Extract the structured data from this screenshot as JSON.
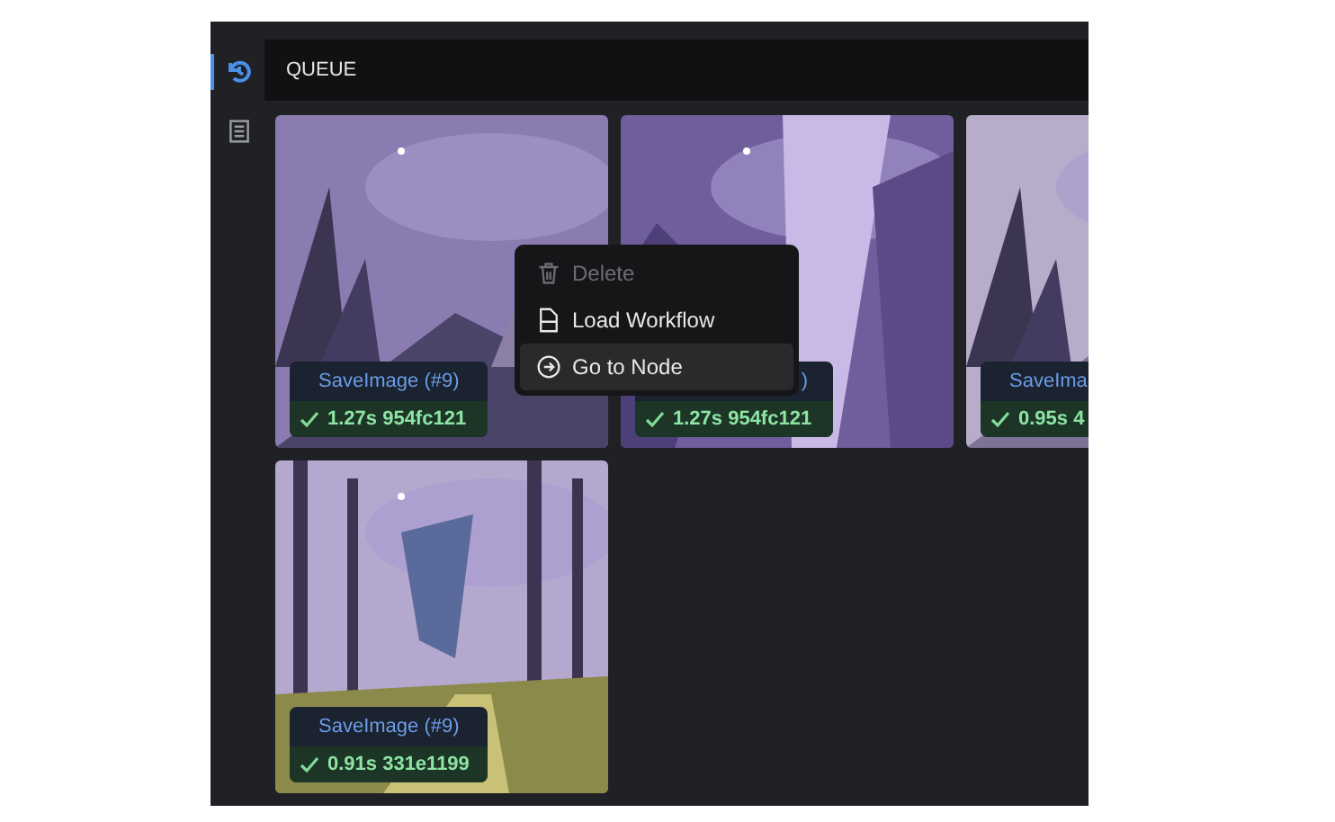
{
  "sidebar": {
    "items": [
      {
        "kind": "history",
        "selected": true
      },
      {
        "kind": "document",
        "selected": false
      }
    ]
  },
  "header": {
    "title": "QUEUE"
  },
  "cards": [
    {
      "kind": "picture",
      "title": "SaveImage (#9)",
      "meta": "1.27s 954fc121"
    },
    {
      "kind": "picture",
      "title": ")",
      "meta": "1.27s 954fc121"
    },
    {
      "kind": "picture",
      "title": "SaveIma",
      "meta": "0.95s 4"
    },
    {
      "kind": "picture",
      "title": "SaveImage (#9)",
      "meta": "0.91s 331e1199"
    }
  ],
  "context_menu": {
    "items": [
      {
        "kind": "delete",
        "label": "Delete",
        "disabled": true,
        "selected": false
      },
      {
        "kind": "load",
        "label": "Load Workflow",
        "disabled": false,
        "selected": false
      },
      {
        "kind": "goto",
        "label": "Go to Node",
        "disabled": false,
        "selected": true
      }
    ]
  }
}
